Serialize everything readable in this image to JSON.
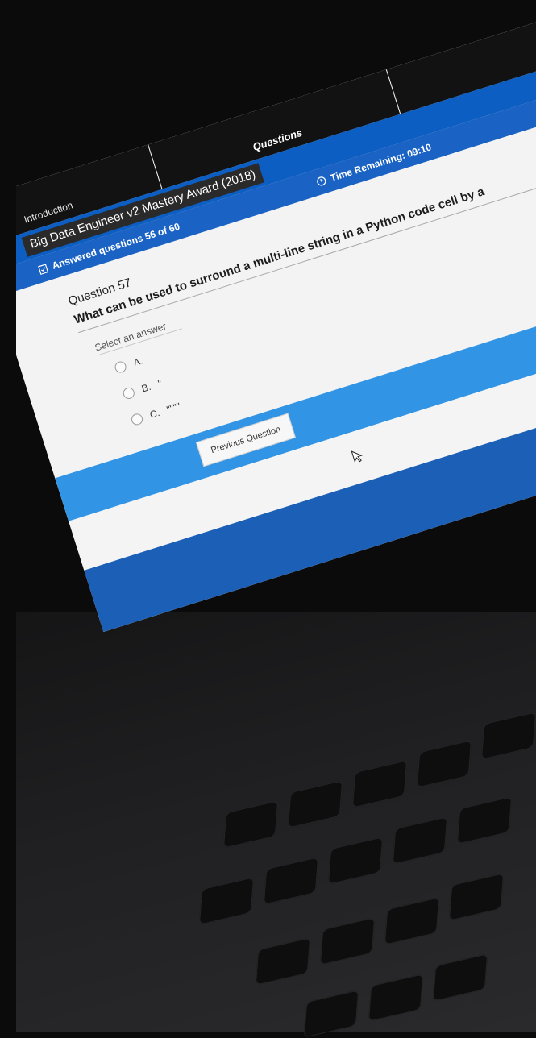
{
  "tabs": {
    "introduction": "Introduction",
    "questions": "Questions"
  },
  "exam": {
    "title": "Big Data Engineer v2 Mastery Award (2018)"
  },
  "status": {
    "answered": "Answered questions 56 of 60",
    "time_remaining": "Time Remaining: 09:10"
  },
  "question": {
    "number": "Question 57",
    "text": "What can be used to surround a multi-line string in a Python code cell by a",
    "select_label": "Select an answer",
    "options": [
      {
        "label": "A.",
        "value": ""
      },
      {
        "label": "B.",
        "value": "\""
      },
      {
        "label": "C.",
        "value": "\"\"\"\""
      }
    ]
  },
  "navigation": {
    "previous": "Previous Question"
  },
  "colors": {
    "header_blue": "#0d5ec2",
    "band_blue": "#3194e4",
    "tab_bg": "#121212"
  }
}
